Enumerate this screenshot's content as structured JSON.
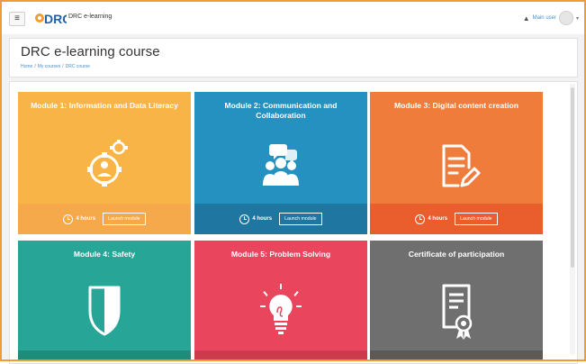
{
  "navbar": {
    "menu_icon": "hamburger-icon",
    "logo_text": "DRC",
    "site_name": "DRC e-learning",
    "notification_icon": "bell-icon",
    "user_name": "Main user",
    "user_menu_icon": "caret-down-icon"
  },
  "header": {
    "title": "DRC e-learning course",
    "breadcrumb": [
      "Home",
      "My courses",
      "DRC course"
    ]
  },
  "tiles": [
    {
      "title": "Module 1: Information and Data Literacy",
      "color": "#f8b446",
      "footer_color": "#f6a94b",
      "icon": "gear-person-icon",
      "hours": "4 hours",
      "button": "Launch module"
    },
    {
      "title": "Module 2: Communication and Collaboration",
      "color": "#2591c1",
      "footer_color": "#1f77a1",
      "icon": "people-chat-icon",
      "hours": "4 hours",
      "button": "Launch module"
    },
    {
      "title": "Module 3: Digital content creation",
      "color": "#ef7c3a",
      "footer_color": "#ea5e2e",
      "icon": "document-edit-icon",
      "hours": "4 hours",
      "button": "Launch module"
    },
    {
      "title": "Module 4: Safety",
      "color": "#27a597",
      "footer_color": "#1f8a7d",
      "icon": "shield-icon",
      "hours": "",
      "button": ""
    },
    {
      "title": "Module 5: Problem Solving",
      "color": "#e9465e",
      "footer_color": "#cc3a50",
      "icon": "lightbulb-icon",
      "hours": "",
      "button": ""
    },
    {
      "title": "Certificate of participation",
      "color": "#6f6f6f",
      "footer_color": "#5a5a5a",
      "icon": "certificate-icon",
      "hours": "",
      "button": ""
    }
  ]
}
